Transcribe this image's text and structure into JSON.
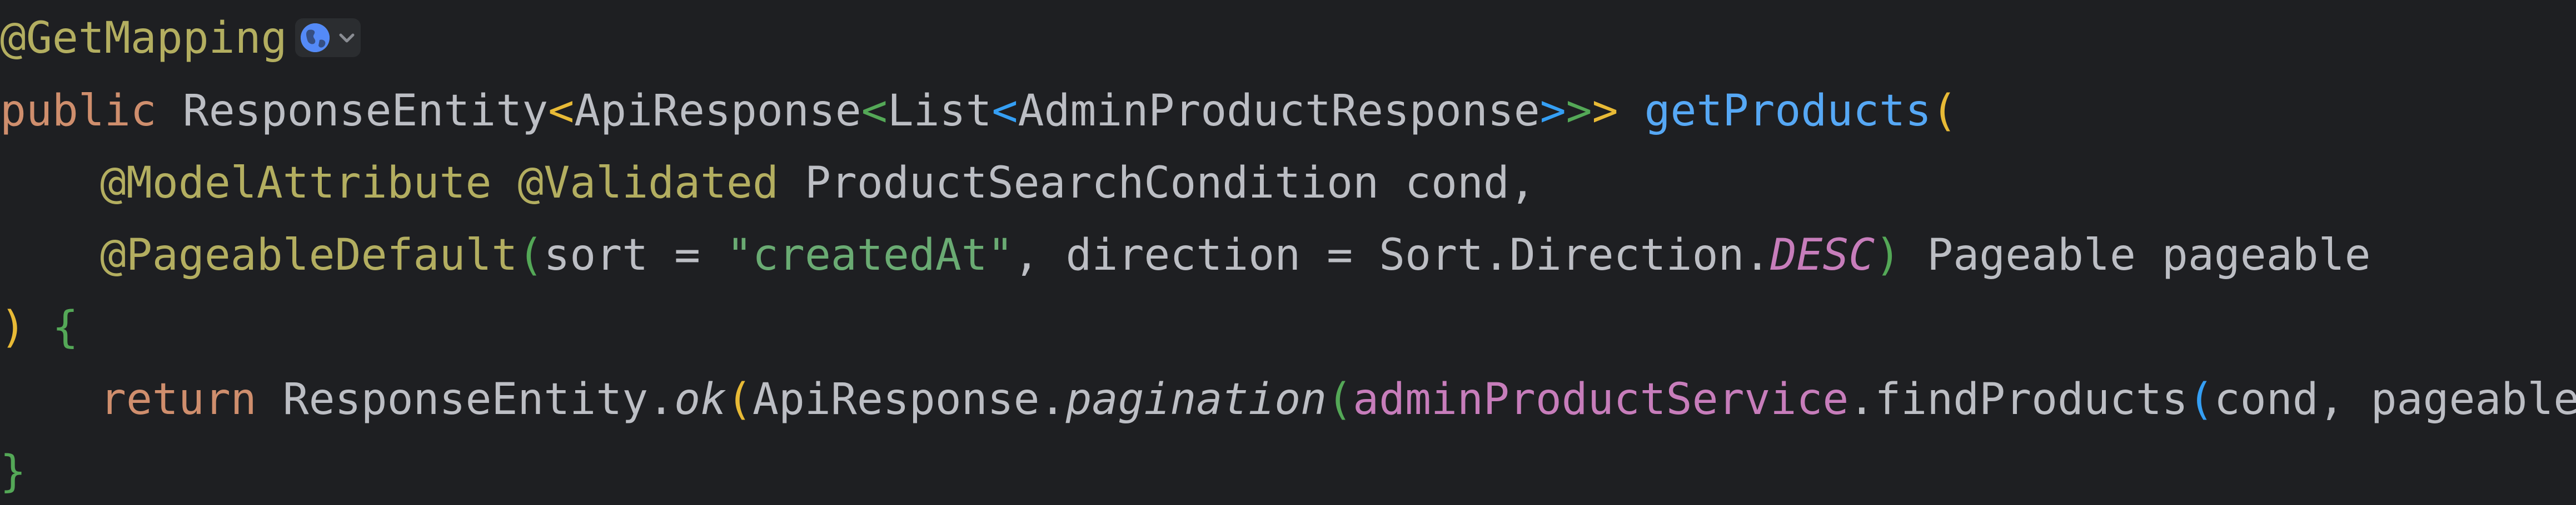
{
  "colors": {
    "background": "#1e1f22",
    "annotation": "#b3ae60",
    "keyword": "#cf8e6d",
    "method": "#56a8f5",
    "string": "#6aab73",
    "field": "#c77dbb",
    "text": "#bcbec4"
  },
  "icons": {
    "endpoint_gutter": "globe-icon",
    "endpoint_dropdown": "chevron-down-icon"
  },
  "code": {
    "line1": {
      "annotation": "@GetMapping"
    },
    "line2": {
      "public": "public",
      "type1": "ResponseEntity",
      "lt1": "<",
      "type2": "ApiResponse",
      "lt2": "<",
      "type3": "List",
      "lt3": "<",
      "type4": "AdminProductResponse",
      "gt3": ">",
      "gt2": ">",
      "gt1": ">",
      "space": " ",
      "method": "getProducts",
      "paren_open": "("
    },
    "line3": {
      "ann1": "@ModelAttribute",
      "ann2": "@Validated",
      "rest": " ProductSearchCondition cond,"
    },
    "line4": {
      "ann": "@PageableDefault",
      "p_open": "(",
      "arg1": "sort = ",
      "str": "\"createdAt\"",
      "arg2": ", direction = Sort.Direction.",
      "const": "DESC",
      "p_close": ")",
      "rest": " Pageable pageable"
    },
    "line5": {
      "paren_close": ")",
      "space": " ",
      "brace_open": "{"
    },
    "line6": {
      "return": "return",
      "t1": " ResponseEntity.",
      "ok": "ok",
      "p1": "(",
      "t2": "ApiResponse.",
      "pagination": "pagination",
      "p2": "(",
      "field": "adminProductService",
      "t3": ".findProducts",
      "p3": "(",
      "args": "cond, pageable",
      "p3c": ")",
      "p2c": ")",
      "p1c": ")",
      "semi": ";"
    },
    "line7": {
      "brace_close": "}"
    }
  }
}
